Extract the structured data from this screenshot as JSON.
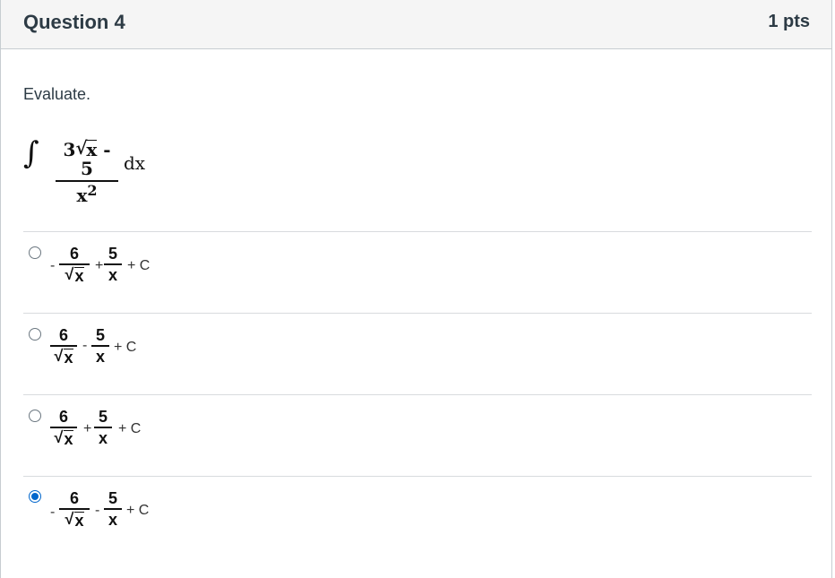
{
  "question": {
    "title": "Question 4",
    "points": "1 pts",
    "prompt": "Evaluate."
  },
  "integral": {
    "sign": "∫",
    "numerator_coef": "3",
    "numerator_radicand": "x",
    "numerator_tail": " - 5",
    "denominator_base": "x",
    "denominator_exp": "2",
    "differential": "dx"
  },
  "answers": [
    {
      "selected": false,
      "lead_sign": "-",
      "term1_num": "6",
      "term1_radicand": "x",
      "mid_op": "+",
      "term2_num": "5",
      "term2_den": "x",
      "tail": "+ C"
    },
    {
      "selected": false,
      "lead_sign": "",
      "term1_num": "6",
      "term1_radicand": "x",
      "mid_op": "-",
      "term2_num": "5",
      "term2_den": "x",
      "tail": "+ C"
    },
    {
      "selected": false,
      "lead_sign": "",
      "term1_num": "6",
      "term1_radicand": "x",
      "mid_op": "+",
      "term2_num": "5",
      "term2_den": "x",
      "tail": "+ C"
    },
    {
      "selected": true,
      "lead_sign": "-",
      "term1_num": "6",
      "term1_radicand": "x",
      "mid_op": "-",
      "term2_num": "5",
      "term2_den": "x",
      "tail": "+ C"
    }
  ],
  "colors": {
    "header_bg": "#f5f5f5",
    "text": "#2d3b45",
    "radio_selected": "#0066cc",
    "divider": "#d8dbde"
  }
}
